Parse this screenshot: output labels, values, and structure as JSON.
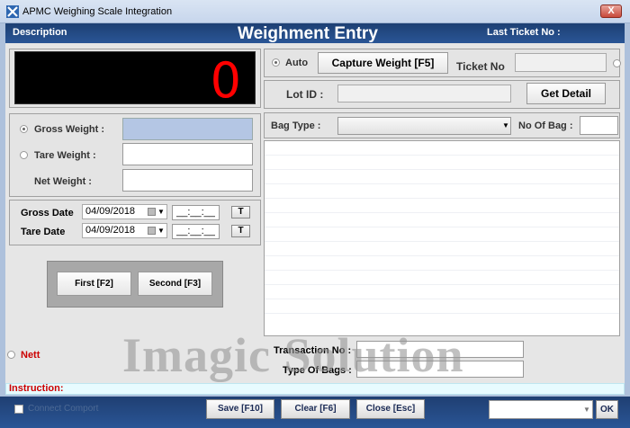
{
  "window": {
    "title": "APMC Weighing Scale Integration",
    "close_label": "X"
  },
  "header": {
    "description": "Description",
    "title": "Weighment Entry",
    "last_ticket_label": "Last Ticket No :"
  },
  "display": {
    "value": "0"
  },
  "weights": {
    "gross_label": "Gross Weight :",
    "tare_label": "Tare Weight  :",
    "net_label": "Net Weight :",
    "gross_value": "",
    "tare_value": "",
    "net_value": ""
  },
  "dates": {
    "gross_label": "Gross Date",
    "tare_label": "Tare Date",
    "gross_date": "04/09/2018",
    "tare_date": "04/09/2018",
    "time_placeholder": "__:__:__",
    "t_button": "T"
  },
  "actions": {
    "first": "First [F2]",
    "second": "Second [F3]"
  },
  "capture": {
    "auto_label": "Auto",
    "capture_button": "Capture Weight [F5]",
    "ticket_no_label": "Ticket No",
    "ticket_no_value": ""
  },
  "lot": {
    "label": "Lot ID :",
    "value": "",
    "get_detail": "Get Detail"
  },
  "bag": {
    "type_label": "Bag Type :",
    "type_value": "",
    "count_label": "No Of Bag :",
    "count_value": ""
  },
  "nett": {
    "label": "Nett"
  },
  "transaction": {
    "no_label": "Transaction No :",
    "type_of_bags_label": "Type Of Bags :",
    "no_value": "",
    "type_of_bags_value": ""
  },
  "watermark": "Imagic Solution",
  "instruction": {
    "label": "Instruction:"
  },
  "footer": {
    "connect_comport": "Connect Comport",
    "save": "Save [F10]",
    "clear": "Clear [F6]",
    "close": "Close [Esc]",
    "ok": "OK",
    "port_value": ""
  },
  "colors": {
    "header_bg": "#1d3f73",
    "display_fg": "#ff0000",
    "accent_red": "#cc0000",
    "gross_field_bg": "#b4c6e4"
  }
}
